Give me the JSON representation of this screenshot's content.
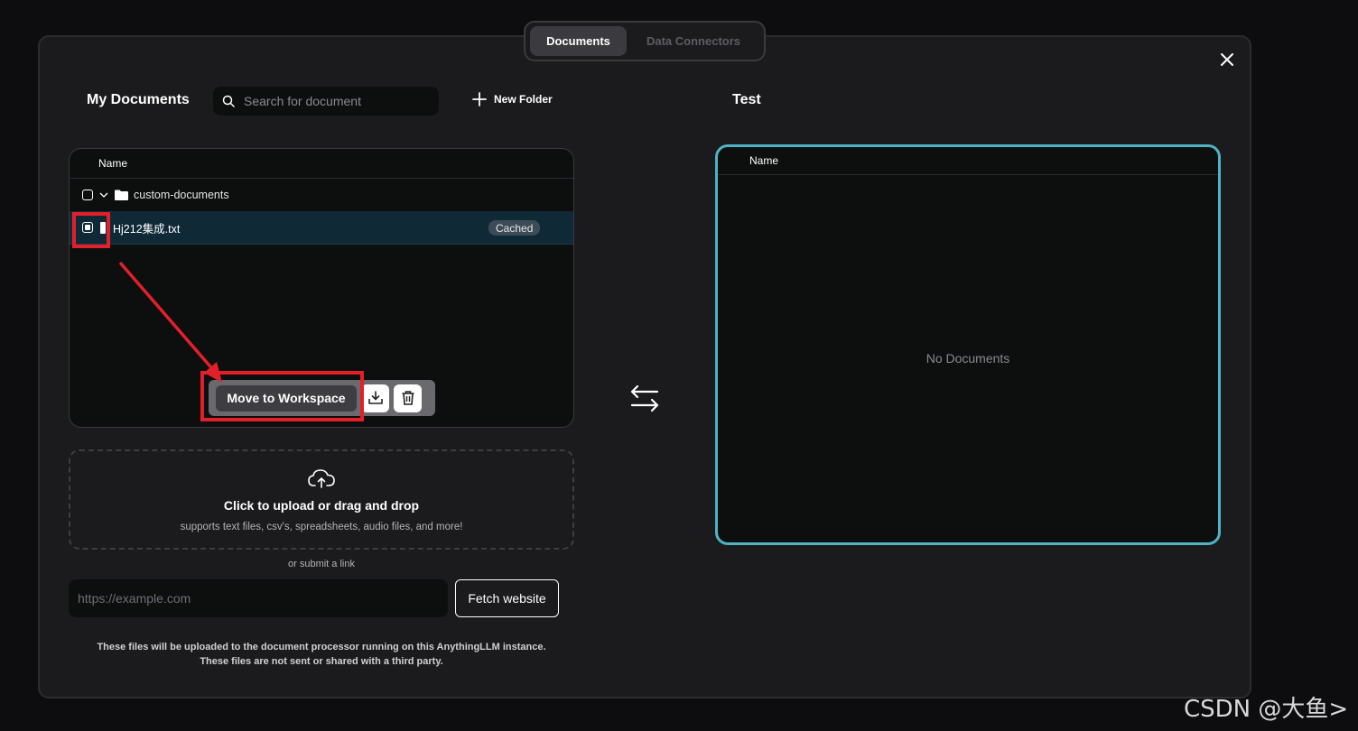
{
  "tabs": [
    {
      "label": "Documents",
      "active": true
    },
    {
      "label": "Data Connectors",
      "active": false
    }
  ],
  "my_documents": {
    "title": "My Documents",
    "search_placeholder": "Search for document",
    "new_folder_label": "New Folder",
    "column_name": "Name",
    "folder": {
      "name": "custom-documents"
    },
    "file": {
      "name": "Hj212集成.txt",
      "badge": "Cached",
      "checked": true
    },
    "actions": {
      "move_label": "Move to Workspace",
      "download_icon": "download-icon",
      "delete_icon": "trash-icon"
    }
  },
  "upload": {
    "title": "Click to upload or drag and drop",
    "subtitle": "supports text files, csv's, spreadsheets, audio files, and more!",
    "or_link": "or submit a link",
    "link_placeholder": "https://example.com",
    "fetch_label": "Fetch website",
    "disclaimer_line1": "These files will be uploaded to the document processor running on this AnythingLLM instance.",
    "disclaimer_line2": "These files are not sent or shared with a third party."
  },
  "workspace": {
    "title": "Test",
    "column_name": "Name",
    "empty_text": "No Documents"
  },
  "watermark": "CSDN @大鱼>",
  "colors": {
    "accent_border": "#4fb3c4",
    "highlight": "#e3202a",
    "selected_row": "#0f2a36"
  }
}
